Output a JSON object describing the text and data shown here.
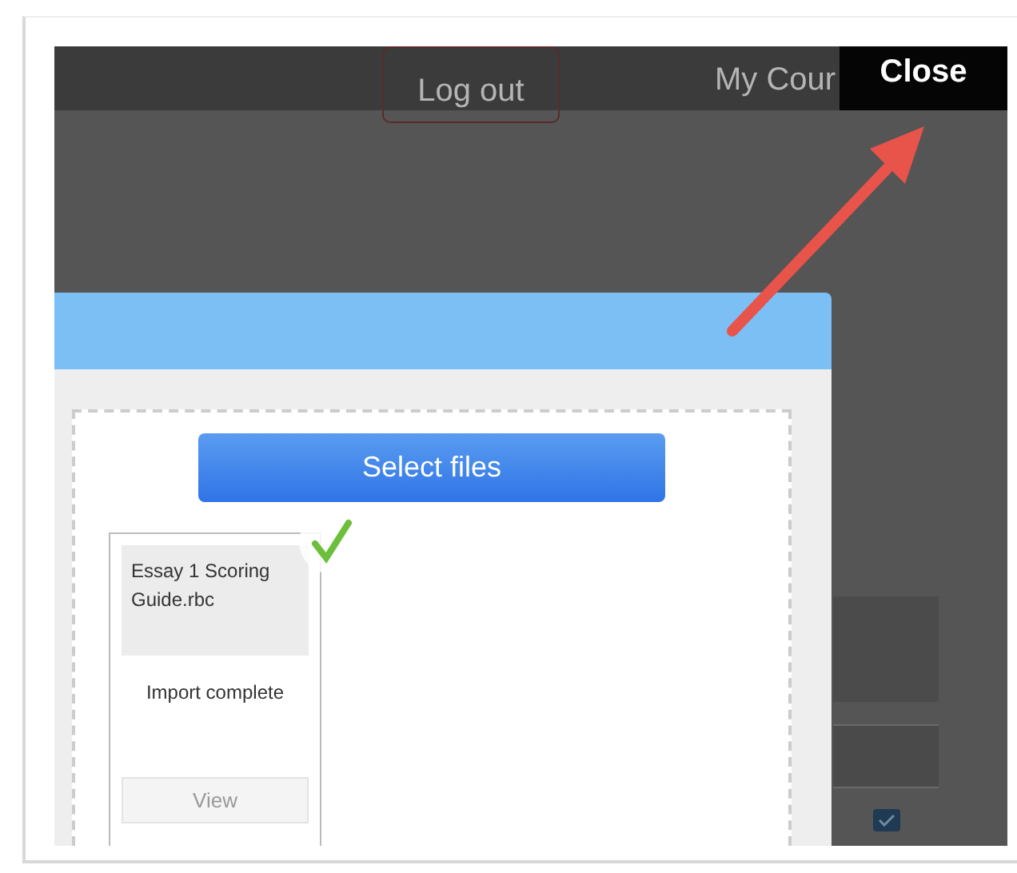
{
  "top_bar": {
    "logout_button": "Log out",
    "nav_link": "My Cour",
    "close_button": "Close"
  },
  "dialog": {
    "select_button": "Select files",
    "files": [
      {
        "name": "Essay 1 Scoring Guide.rbc",
        "status": "Import complete",
        "done": true,
        "view_button": {
          "label": "View",
          "disabled": true
        }
      }
    ]
  },
  "background_table": {
    "checkbox": {
      "checked": true
    }
  }
}
